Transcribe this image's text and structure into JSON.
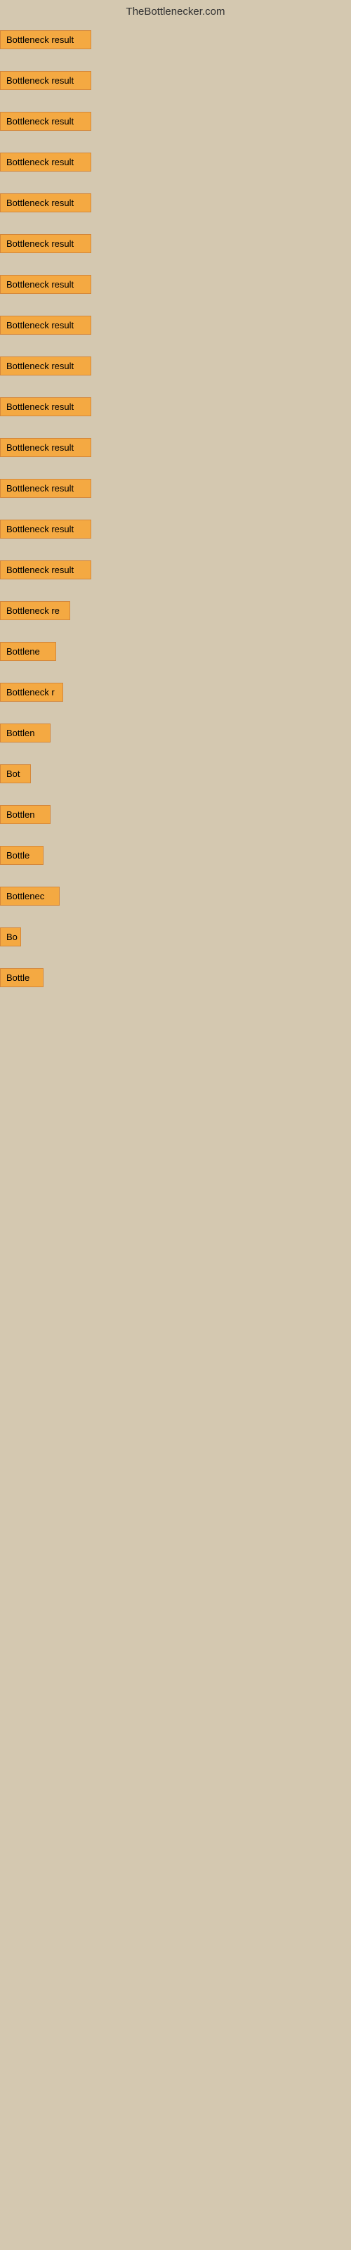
{
  "site_title": "TheBottlenecker.com",
  "items": [
    {
      "id": 1,
      "label": "Bottleneck result",
      "width": 130
    },
    {
      "id": 2,
      "label": "Bottleneck result",
      "width": 130
    },
    {
      "id": 3,
      "label": "Bottleneck result",
      "width": 130
    },
    {
      "id": 4,
      "label": "Bottleneck result",
      "width": 130
    },
    {
      "id": 5,
      "label": "Bottleneck result",
      "width": 130
    },
    {
      "id": 6,
      "label": "Bottleneck result",
      "width": 130
    },
    {
      "id": 7,
      "label": "Bottleneck result",
      "width": 130
    },
    {
      "id": 8,
      "label": "Bottleneck result",
      "width": 130
    },
    {
      "id": 9,
      "label": "Bottleneck result",
      "width": 130
    },
    {
      "id": 10,
      "label": "Bottleneck result",
      "width": 130
    },
    {
      "id": 11,
      "label": "Bottleneck result",
      "width": 130
    },
    {
      "id": 12,
      "label": "Bottleneck result",
      "width": 130
    },
    {
      "id": 13,
      "label": "Bottleneck result",
      "width": 130
    },
    {
      "id": 14,
      "label": "Bottleneck result",
      "width": 130
    },
    {
      "id": 15,
      "label": "Bottleneck re",
      "width": 100
    },
    {
      "id": 16,
      "label": "Bottlene",
      "width": 80
    },
    {
      "id": 17,
      "label": "Bottleneck r",
      "width": 90
    },
    {
      "id": 18,
      "label": "Bottlen",
      "width": 72
    },
    {
      "id": 19,
      "label": "Bot",
      "width": 44
    },
    {
      "id": 20,
      "label": "Bottlen",
      "width": 72
    },
    {
      "id": 21,
      "label": "Bottle",
      "width": 62
    },
    {
      "id": 22,
      "label": "Bottlenec",
      "width": 85
    },
    {
      "id": 23,
      "label": "Bo",
      "width": 30
    },
    {
      "id": 24,
      "label": "Bottle",
      "width": 62
    }
  ],
  "colors": {
    "badge_bg": "#f4a942",
    "badge_border": "#d4873a",
    "body_bg": "#d4c8b0"
  }
}
